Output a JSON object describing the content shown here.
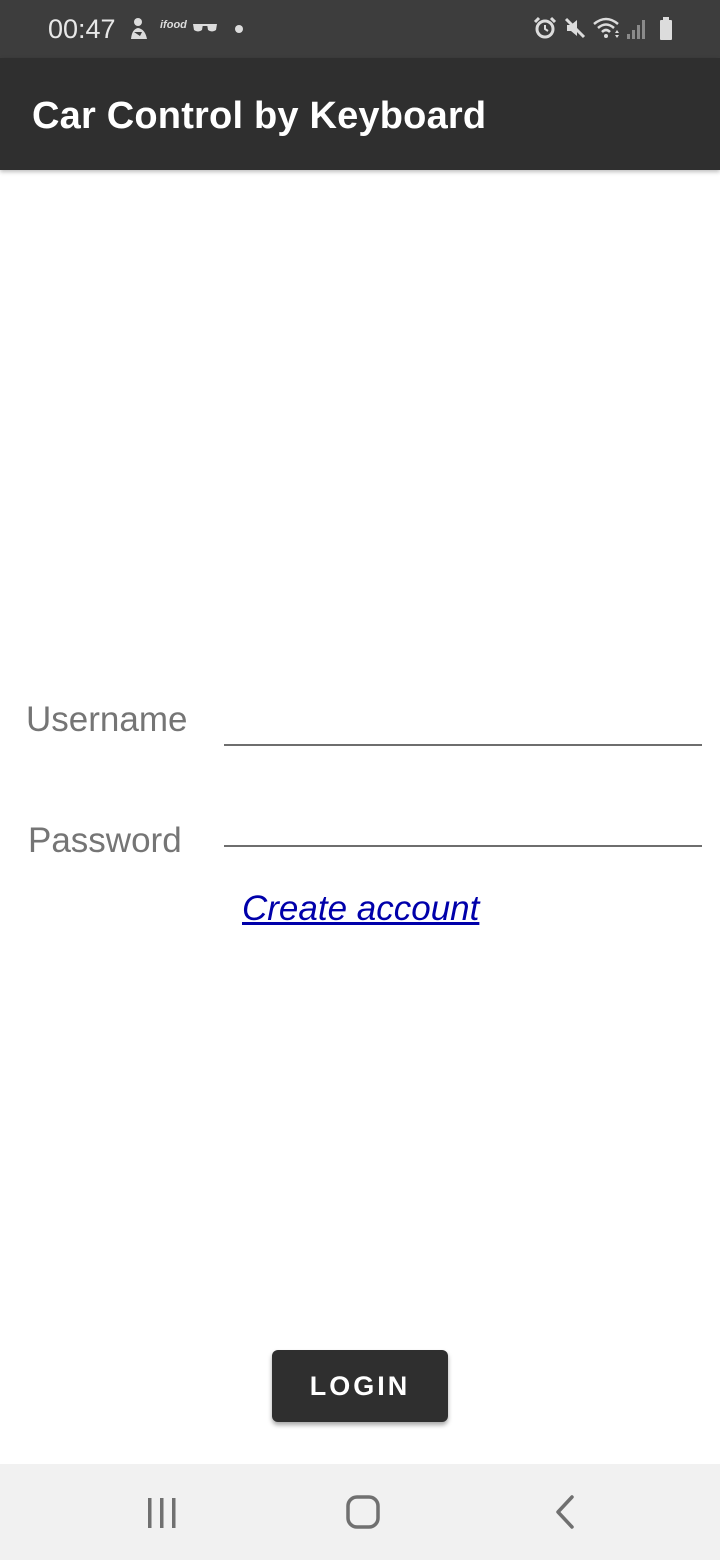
{
  "status_bar": {
    "time": "00:47",
    "ifood_label": "ifood",
    "icons": [
      "person-notification-icon",
      "ifood-icon",
      "glasses-icon",
      "dot-icon",
      "alarm-icon",
      "mute-icon",
      "wifi-icon",
      "signal-icon",
      "battery-icon"
    ]
  },
  "app_bar": {
    "title": "Car Control by Keyboard"
  },
  "form": {
    "username_label": "Username",
    "username_value": "",
    "password_label": "Password",
    "password_value": "",
    "create_account_link": "Create account",
    "login_button": "LOGIN"
  },
  "nav_bar": {
    "icons": [
      "recents-icon",
      "home-icon",
      "back-icon"
    ]
  },
  "colors": {
    "status_bar_bg": "#3d3d3d",
    "app_bar_bg": "#2f2f2f",
    "label_gray": "#757575",
    "link_blue": "#0000aa",
    "button_bg": "#2f2f2f",
    "nav_bar_bg": "#f1f1f1"
  }
}
